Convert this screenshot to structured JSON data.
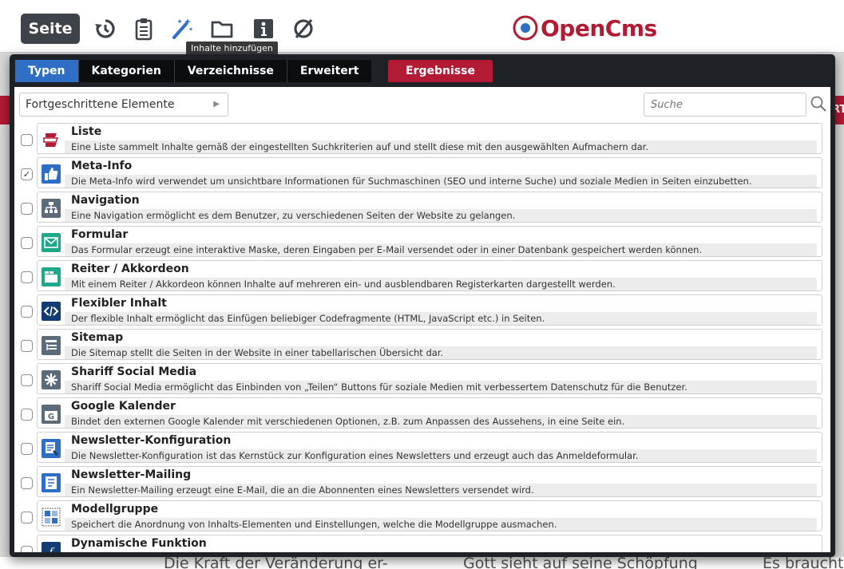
{
  "toolbar": {
    "seite_label": "Seite",
    "icons": [
      "history-icon",
      "clipboard-icon",
      "magic-wand-icon",
      "folder-icon",
      "info-icon",
      "disabled-icon"
    ],
    "tooltip": "Inhalte hinzufügen",
    "logo_text": "OpenCms",
    "brand_color": "#b31b34"
  },
  "background": {
    "bottom_texts": [
      "Die Kraft der Veränderung er-",
      "Gott sieht auf seine Schöpfung",
      "Es braucht"
    ],
    "right_strip_text": "RT"
  },
  "dialog": {
    "tabs": [
      "Typen",
      "Kategorien",
      "Verzeichnisse",
      "Erweitert"
    ],
    "active_tab": "Typen",
    "results_tab": "Ergebnisse",
    "filter_value": "Fortgeschrittene Elemente",
    "search_placeholder": "Suche",
    "items": [
      {
        "title": "Liste",
        "desc": "Eine Liste sammelt Inhalte gemäß der eingestellten Suchkriterien auf und stellt diese mit den ausgewählten Aufmachern dar.",
        "icon": "list-icon",
        "checked": false
      },
      {
        "title": "Meta-Info",
        "desc": "Die Meta-Info wird verwendet um unsichtbare Informationen für Suchmaschinen (SEO und interne Suche) und soziale Medien in Seiten einzubetten.",
        "icon": "thumbs-up-icon",
        "checked": true
      },
      {
        "title": "Navigation",
        "desc": "Eine Navigation ermöglicht es dem Benutzer, zu verschiedenen Seiten der Website zu gelangen.",
        "icon": "sitemap-tree-icon",
        "checked": false
      },
      {
        "title": "Formular",
        "desc": "Das Formular erzeugt eine interaktive Maske, deren Eingaben per E-Mail versendet oder in einer Datenbank gespeichert werden können.",
        "icon": "envelope-icon",
        "checked": false
      },
      {
        "title": "Reiter / Akkordeon",
        "desc": "Mit einem Reiter / Akkordeon können Inhalte auf mehreren ein- und ausblendbaren Registerkarten dargestellt werden.",
        "icon": "tabs-icon",
        "checked": false
      },
      {
        "title": "Flexibler Inhalt",
        "desc": "Der flexible Inhalt ermöglicht das Einfügen beliebiger Codefragmente (HTML, JavaScript etc.) in Seiten.",
        "icon": "code-icon",
        "checked": false
      },
      {
        "title": "Sitemap",
        "desc": "Die Sitemap stellt die Seiten in der Website in einer tabellarischen Übersicht dar.",
        "icon": "sitemap-list-icon",
        "checked": false
      },
      {
        "title": "Shariff Social Media",
        "desc": "Shariff Social Media ermöglicht das Einbinden von „Teilen“ Buttons für soziale Medien mit verbessertem Datenschutz für die Benutzer.",
        "icon": "share-star-icon",
        "checked": false
      },
      {
        "title": "Google Kalender",
        "desc": "Bindet den externen Google Kalender mit verschiedenen Optionen, z.B. zum Anpassen des Aussehens, in eine Seite ein.",
        "icon": "google-calendar-icon",
        "checked": false
      },
      {
        "title": "Newsletter-Konfiguration",
        "desc": "Die Newsletter-Konfiguration ist das Kernstück zur Konfiguration eines Newsletters und erzeugt auch das Anmeldeformular.",
        "icon": "newsletter-config-icon",
        "checked": false
      },
      {
        "title": "Newsletter-Mailing",
        "desc": "Ein Newsletter-Mailing erzeugt eine E-Mail, die an die Abonnenten eines Newsletters versendet wird.",
        "icon": "newsletter-mailing-icon",
        "checked": false
      },
      {
        "title": "Modellgruppe",
        "desc": "Speichert die Anordnung von Inhalts-Elementen und Einstellungen, welche die Modellgruppe ausmachen.",
        "icon": "model-group-icon",
        "checked": false
      },
      {
        "title": "Dynamische Funktion",
        "desc": "",
        "icon": "function-icon",
        "checked": false
      }
    ]
  }
}
